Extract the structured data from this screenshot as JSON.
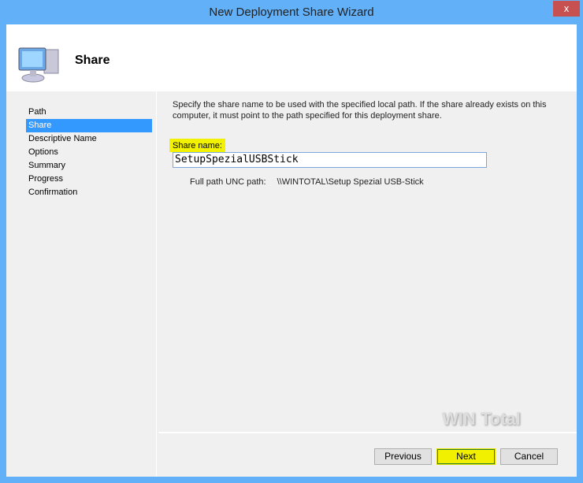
{
  "window": {
    "title": "New Deployment Share Wizard",
    "close_label": "x"
  },
  "header": {
    "title": "Share"
  },
  "sidebar": {
    "items": [
      {
        "label": "Path"
      },
      {
        "label": "Share"
      },
      {
        "label": "Descriptive Name"
      },
      {
        "label": "Options"
      },
      {
        "label": "Summary"
      },
      {
        "label": "Progress"
      },
      {
        "label": "Confirmation"
      }
    ],
    "selected": "Share"
  },
  "main": {
    "description": "Specify the share name to be used with the specified local path.  If the share already exists on this computer, it must point to the path specified for this deployment share.",
    "share_name_label": "Share name:",
    "share_name_value": "SetupSpezialUSBStick",
    "unc_label": "Full path UNC path:",
    "unc_value": "\\\\WINTOTAL\\Setup Spezial USB-Stick"
  },
  "watermark": "WIN Total",
  "buttons": {
    "previous": "Previous",
    "next": "Next",
    "cancel": "Cancel"
  }
}
